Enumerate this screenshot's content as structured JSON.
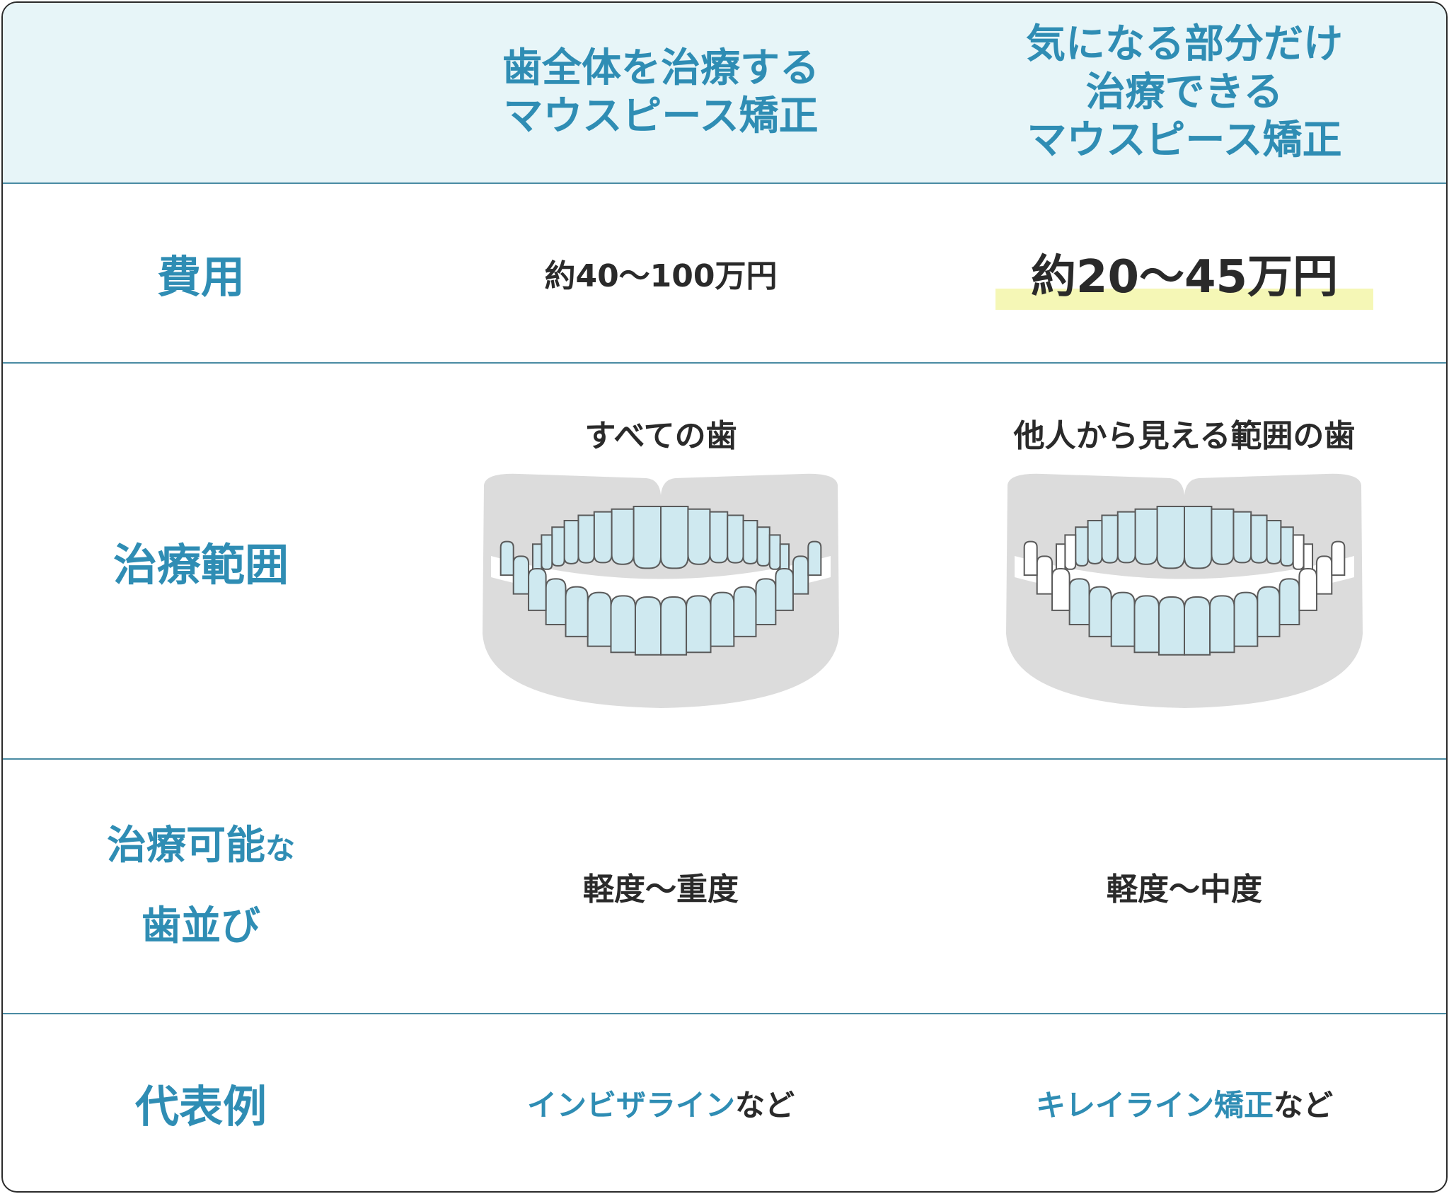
{
  "headers": {
    "col1": [
      "歯全体を治療する",
      "マウスピース矯正"
    ],
    "col2": [
      "気になる部分だけ",
      "治療できる",
      "マウスピース矯正"
    ]
  },
  "rows": {
    "cost": {
      "label": "費用",
      "col1": "約40〜100万円",
      "col2": "約20〜45万円"
    },
    "scope": {
      "label": "治療範囲",
      "col1_caption": "すべての歯",
      "col2_caption": "他人から見える範囲の歯",
      "col1_highlighted_teeth": "all",
      "col2_highlighted_teeth": "front"
    },
    "alignment": {
      "label_line1_main": "治療可能",
      "label_line1_small": "な",
      "label_line2": "歯並び",
      "col1": "軽度〜重度",
      "col2": "軽度〜中度"
    },
    "examples": {
      "label": "代表例",
      "col1_name": "インビザライン",
      "col1_suffix": "など",
      "col2_name": "キレイライン矯正",
      "col2_suffix": "など"
    }
  },
  "colors": {
    "accent_blue": "#2f8db4",
    "header_bg": "#e7f5f8",
    "divider": "#4a8ba3",
    "text_dark": "#2a2a2a",
    "highlight_marker": "#f5f7b6",
    "tooth_highlight": "#cfe9f0",
    "gum_gray": "#dcdcdc"
  }
}
